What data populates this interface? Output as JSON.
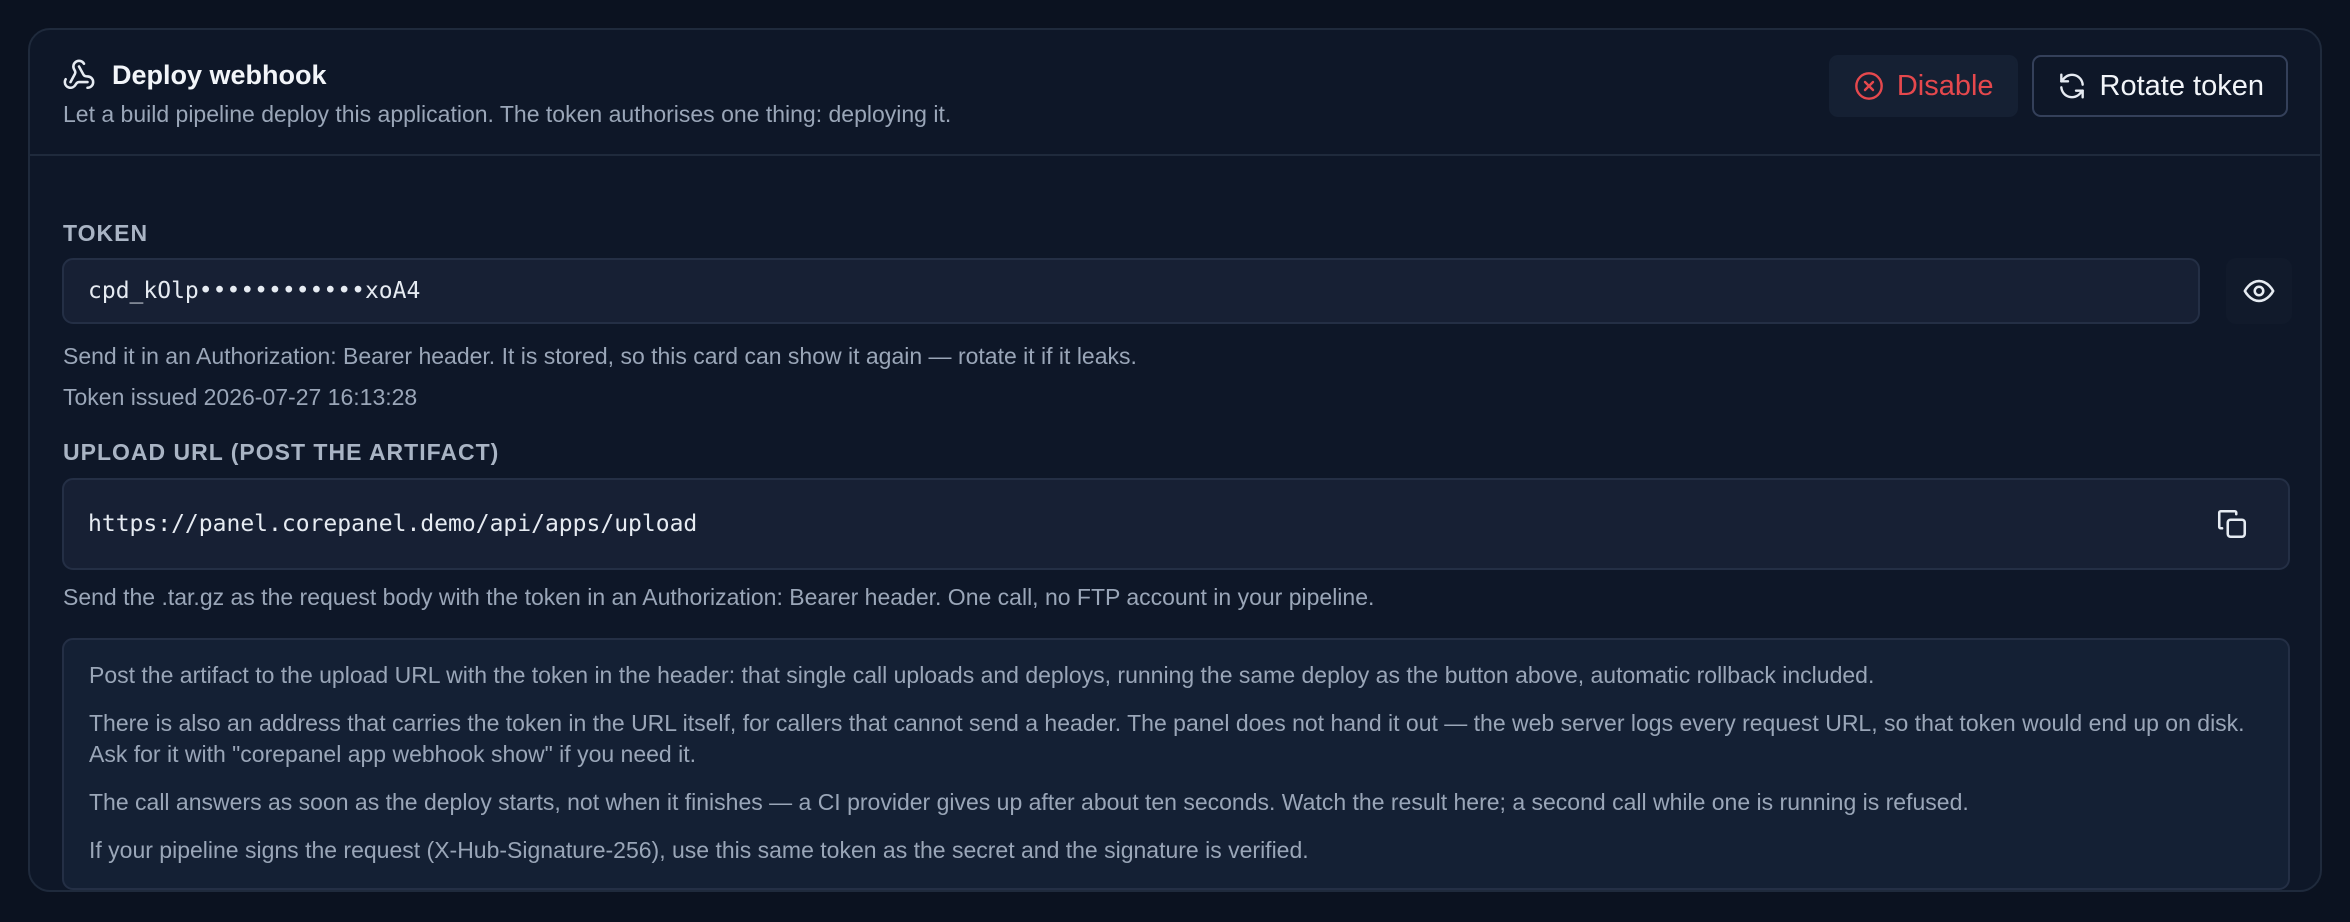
{
  "card": {
    "icon": "webhook-icon",
    "title": "Deploy webhook",
    "subtitle": "Let a build pipeline deploy this application. The token authorises one thing: deploying it.",
    "actions": {
      "disable": {
        "label": "Disable",
        "icon": "x-circle-icon",
        "color": "#e5484d"
      },
      "rotate": {
        "label": "Rotate token",
        "icon": "refresh-icon"
      }
    }
  },
  "token": {
    "label": "TOKEN",
    "value": "cpd_kOlp••••••••••••xoA4",
    "reveal_icon": "eye-icon",
    "hint": "Send it in an Authorization: Bearer header. It is stored, so this card can show it again — rotate it if it leaks.",
    "issued": "Token issued 2026-07-27 16:13:28"
  },
  "upload": {
    "label": "UPLOAD URL (POST THE ARTIFACT)",
    "url": "https://panel.corepanel.demo/api/apps/upload",
    "copy_icon": "copy-icon",
    "hint": "Send the .tar.gz as the request body with the token in an Authorization: Bearer header. One call, no FTP account in your pipeline."
  },
  "notes": [
    "Post the artifact to the upload URL with the token in the header: that single call uploads and deploys, running the same deploy as the button above, automatic rollback included.",
    "There is also an address that carries the token in the URL itself, for callers that cannot send a header. The panel does not hand it out — the web server logs every request URL, so that token would end up on disk. Ask for it with \"corepanel app webhook show\" if you need it.",
    "The call answers as soon as the deploy starts, not when it finishes — a CI provider gives up after about ten seconds. Watch the result here; a second call while one is running is refused.",
    "If your pipeline signs the request (X-Hub-Signature-256), use this same token as the secret and the signature is verified."
  ]
}
